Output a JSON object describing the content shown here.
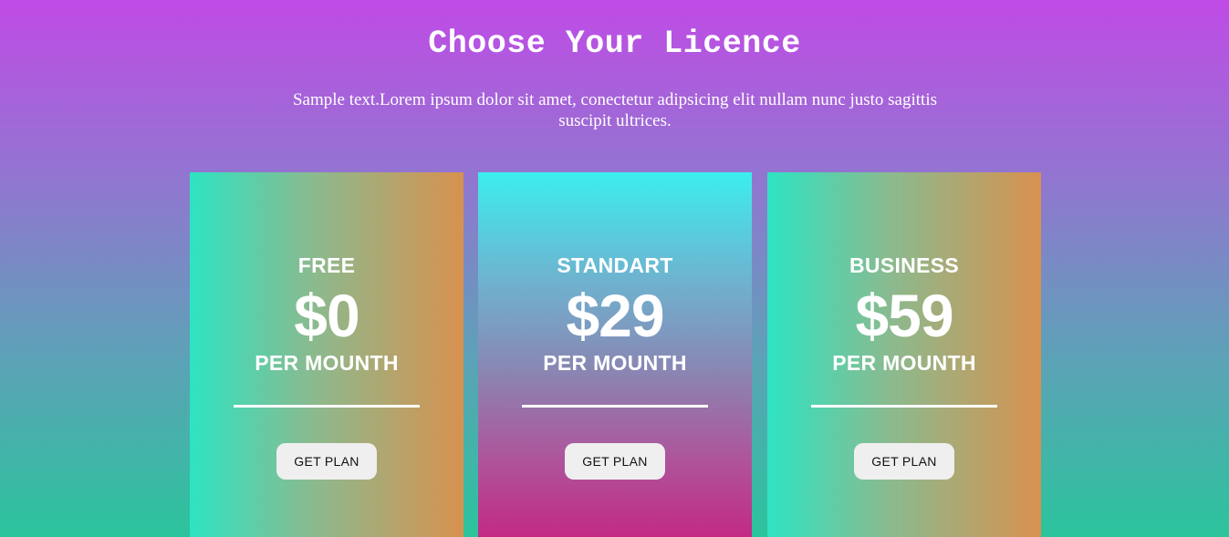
{
  "header": {
    "title": "Choose Your Licence",
    "subtitle": "Sample text.Lorem ipsum dolor sit amet, conectetur adipsicing elit nullam nunc justo sagittis suscipit ultrices."
  },
  "plans": [
    {
      "name": "FREE",
      "price": "$0",
      "period": "PER MOUNTH",
      "button_label": "GET PLAN"
    },
    {
      "name": "STANDART",
      "price": "$29",
      "period": "PER MOUNTH",
      "button_label": "GET PLAN"
    },
    {
      "name": "BUSINESS",
      "price": "$59",
      "period": "PER MOUNTH",
      "button_label": "GET PLAN"
    }
  ],
  "colors": {
    "page_gradient_top": "#c04be6",
    "page_gradient_bottom": "#2bc49c",
    "side_card_left": "#2ee3c2",
    "side_card_right": "#d8914f",
    "middle_card_top": "#3ceeee",
    "middle_card_bottom": "#c22a86",
    "button_bg": "#efefef"
  }
}
